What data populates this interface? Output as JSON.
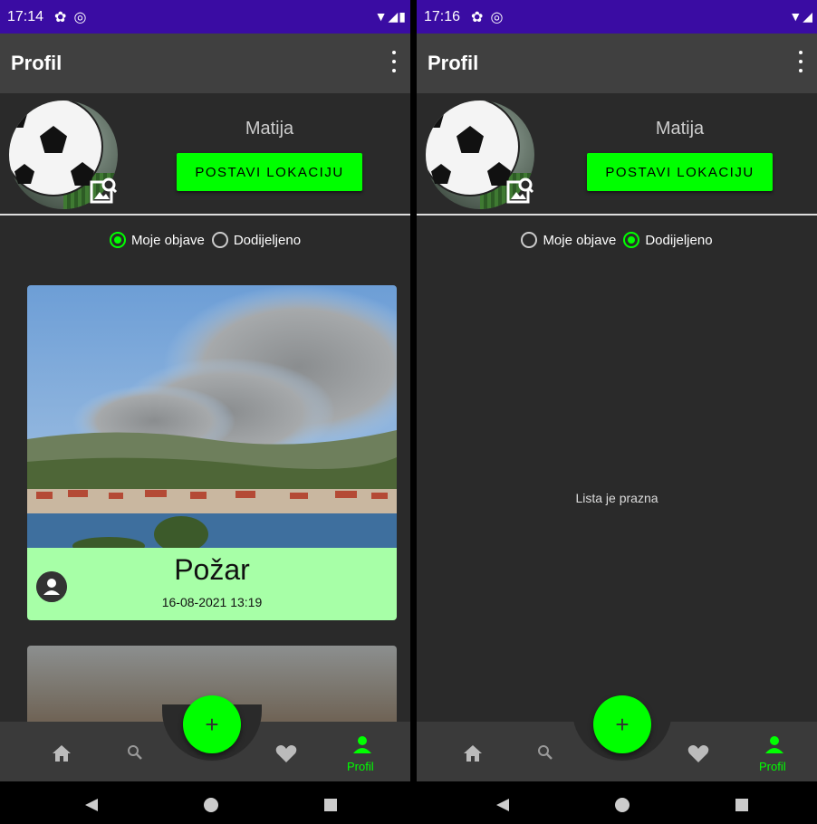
{
  "left": {
    "status": {
      "time": "17:14"
    },
    "appbar": {
      "title": "Profil"
    },
    "profile": {
      "name": "Matija",
      "location_button": "POSTAVI LOKACIJU"
    },
    "filter": {
      "options": [
        "Moje objave",
        "Dodijeljeno"
      ],
      "selected": "Moje objave"
    },
    "posts": [
      {
        "title": "Požar",
        "date": "16-08-2021 13:19"
      }
    ],
    "nav": {
      "active_label": "Profil",
      "fab": "+"
    }
  },
  "right": {
    "status": {
      "time": "17:16"
    },
    "appbar": {
      "title": "Profil"
    },
    "profile": {
      "name": "Matija",
      "location_button": "POSTAVI LOKACIJU"
    },
    "filter": {
      "options": [
        "Moje objave",
        "Dodijeljeno"
      ],
      "selected": "Dodijeljeno"
    },
    "empty_text": "Lista je prazna",
    "nav": {
      "active_label": "Profil",
      "fab": "+"
    }
  },
  "icons": [
    "settings-icon",
    "notification-icon",
    "wifi-icon",
    "signal-icon",
    "battery-icon",
    "more-vert-icon",
    "image-search-icon",
    "person-icon",
    "home-icon",
    "search-icon",
    "heart-icon",
    "back-icon",
    "home-circle-icon",
    "recents-icon"
  ],
  "colors": {
    "accent": "#00ff00",
    "status_bar": "#3a0ca3",
    "app_bar": "#404040",
    "background": "#2a2a2a",
    "card_footer": "#a7ffa7"
  }
}
